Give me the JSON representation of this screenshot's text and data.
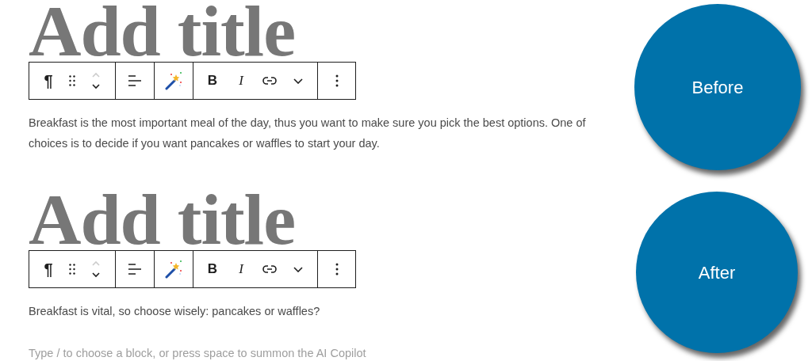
{
  "panels": [
    {
      "title": "Add title",
      "toolbar": {
        "pilcrow": "¶",
        "bold": "B",
        "italic": "I"
      },
      "paragraph_lines": [
        "Breakfast is the most important meal of the day, thus you want to make sure you pick the best options. One of",
        "choices is to decide if you want pancakes or waffles to start your day."
      ],
      "badge": "Before"
    },
    {
      "title": "Add title",
      "toolbar": {
        "pilcrow": "¶",
        "bold": "B",
        "italic": "I"
      },
      "paragraph_lines": [
        "Breakfast is vital, so choose wisely: pancakes or waffles?"
      ],
      "placeholder": "Type / to choose a block, or press space to summon the AI Copilot",
      "badge": "After"
    }
  ]
}
